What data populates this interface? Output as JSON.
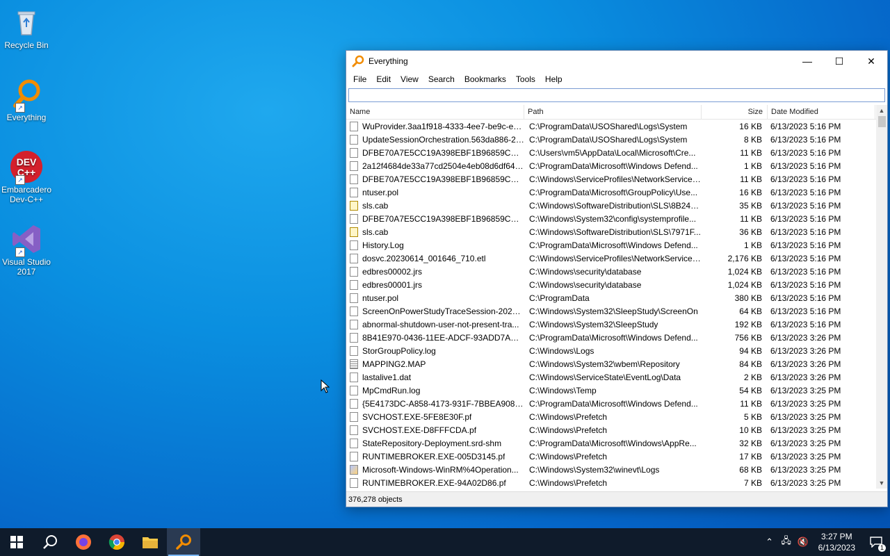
{
  "desktop": {
    "icons": [
      {
        "label": "Recycle Bin"
      },
      {
        "label": "Everything"
      },
      {
        "label": "Embarcadero Dev-C++"
      },
      {
        "label": "Visual Studio 2017"
      }
    ]
  },
  "window": {
    "title": "Everything",
    "controls": {
      "minimize": "—",
      "maximize": "☐",
      "close": "✕"
    },
    "menu": [
      "File",
      "Edit",
      "View",
      "Search",
      "Bookmarks",
      "Tools",
      "Help"
    ],
    "search": {
      "value": "",
      "placeholder": ""
    },
    "columns": {
      "name": "Name",
      "path": "Path",
      "size": "Size",
      "date": "Date Modified"
    },
    "rows": [
      {
        "name": "WuProvider.3aa1f918-4333-4ee7-be9c-e5a...",
        "path": "C:\\ProgramData\\USOShared\\Logs\\System",
        "size": "16 KB",
        "date": "6/13/2023 5:16 PM",
        "icon": "file"
      },
      {
        "name": "UpdateSessionOrchestration.563da886-21...",
        "path": "C:\\ProgramData\\USOShared\\Logs\\System",
        "size": "8 KB",
        "date": "6/13/2023 5:16 PM",
        "icon": "file"
      },
      {
        "name": "DFBE70A7E5CC19A398EBF1B96859CE5D",
        "path": "C:\\Users\\vm5\\AppData\\Local\\Microsoft\\Cre...",
        "size": "11 KB",
        "date": "6/13/2023 5:16 PM",
        "icon": "file"
      },
      {
        "name": "2a12f4684de33a77cd2504e4eb08d6df649b...",
        "path": "C:\\ProgramData\\Microsoft\\Windows Defend...",
        "size": "1 KB",
        "date": "6/13/2023 5:16 PM",
        "icon": "file"
      },
      {
        "name": "DFBE70A7E5CC19A398EBF1B96859CE5D",
        "path": "C:\\Windows\\ServiceProfiles\\NetworkService\\...",
        "size": "11 KB",
        "date": "6/13/2023 5:16 PM",
        "icon": "file"
      },
      {
        "name": "ntuser.pol",
        "path": "C:\\ProgramData\\Microsoft\\GroupPolicy\\Use...",
        "size": "16 KB",
        "date": "6/13/2023 5:16 PM",
        "icon": "file"
      },
      {
        "name": "sls.cab",
        "path": "C:\\Windows\\SoftwareDistribution\\SLS\\8B24B...",
        "size": "35 KB",
        "date": "6/13/2023 5:16 PM",
        "icon": "cab"
      },
      {
        "name": "DFBE70A7E5CC19A398EBF1B96859CE5D",
        "path": "C:\\Windows\\System32\\config\\systemprofile...",
        "size": "11 KB",
        "date": "6/13/2023 5:16 PM",
        "icon": "file"
      },
      {
        "name": "sls.cab",
        "path": "C:\\Windows\\SoftwareDistribution\\SLS\\7971F...",
        "size": "36 KB",
        "date": "6/13/2023 5:16 PM",
        "icon": "cab"
      },
      {
        "name": "History.Log",
        "path": "C:\\ProgramData\\Microsoft\\Windows Defend...",
        "size": "1 KB",
        "date": "6/13/2023 5:16 PM",
        "icon": "file"
      },
      {
        "name": "dosvc.20230614_001646_710.etl",
        "path": "C:\\Windows\\ServiceProfiles\\NetworkService\\...",
        "size": "2,176 KB",
        "date": "6/13/2023 5:16 PM",
        "icon": "file"
      },
      {
        "name": "edbres00002.jrs",
        "path": "C:\\Windows\\security\\database",
        "size": "1,024 KB",
        "date": "6/13/2023 5:16 PM",
        "icon": "file"
      },
      {
        "name": "edbres00001.jrs",
        "path": "C:\\Windows\\security\\database",
        "size": "1,024 KB",
        "date": "6/13/2023 5:16 PM",
        "icon": "file"
      },
      {
        "name": "ntuser.pol",
        "path": "C:\\ProgramData",
        "size": "380 KB",
        "date": "6/13/2023 5:16 PM",
        "icon": "file"
      },
      {
        "name": "ScreenOnPowerStudyTraceSession-2023-0...",
        "path": "C:\\Windows\\System32\\SleepStudy\\ScreenOn",
        "size": "64 KB",
        "date": "6/13/2023 5:16 PM",
        "icon": "file"
      },
      {
        "name": "abnormal-shutdown-user-not-present-tra...",
        "path": "C:\\Windows\\System32\\SleepStudy",
        "size": "192 KB",
        "date": "6/13/2023 5:16 PM",
        "icon": "file"
      },
      {
        "name": "8B41E970-0436-11EE-ADCF-93ADD7AD677...",
        "path": "C:\\ProgramData\\Microsoft\\Windows Defend...",
        "size": "756 KB",
        "date": "6/13/2023 3:26 PM",
        "icon": "file"
      },
      {
        "name": "StorGroupPolicy.log",
        "path": "C:\\Windows\\Logs",
        "size": "94 KB",
        "date": "6/13/2023 3:26 PM",
        "icon": "file"
      },
      {
        "name": "MAPPING2.MAP",
        "path": "C:\\Windows\\System32\\wbem\\Repository",
        "size": "84 KB",
        "date": "6/13/2023 3:26 PM",
        "icon": "map"
      },
      {
        "name": "lastalive1.dat",
        "path": "C:\\Windows\\ServiceState\\EventLog\\Data",
        "size": "2 KB",
        "date": "6/13/2023 3:26 PM",
        "icon": "file"
      },
      {
        "name": "MpCmdRun.log",
        "path": "C:\\Windows\\Temp",
        "size": "54 KB",
        "date": "6/13/2023 3:25 PM",
        "icon": "file"
      },
      {
        "name": "{5E4173DC-A858-4173-931F-7BBEA908BF4...",
        "path": "C:\\ProgramData\\Microsoft\\Windows Defend...",
        "size": "11 KB",
        "date": "6/13/2023 3:25 PM",
        "icon": "file"
      },
      {
        "name": "SVCHOST.EXE-5FE8E30F.pf",
        "path": "C:\\Windows\\Prefetch",
        "size": "5 KB",
        "date": "6/13/2023 3:25 PM",
        "icon": "file"
      },
      {
        "name": "SVCHOST.EXE-D8FFFCDA.pf",
        "path": "C:\\Windows\\Prefetch",
        "size": "10 KB",
        "date": "6/13/2023 3:25 PM",
        "icon": "file"
      },
      {
        "name": "StateRepository-Deployment.srd-shm",
        "path": "C:\\ProgramData\\Microsoft\\Windows\\AppRe...",
        "size": "32 KB",
        "date": "6/13/2023 3:25 PM",
        "icon": "file"
      },
      {
        "name": "RUNTIMEBROKER.EXE-005D3145.pf",
        "path": "C:\\Windows\\Prefetch",
        "size": "17 KB",
        "date": "6/13/2023 3:25 PM",
        "icon": "file"
      },
      {
        "name": "Microsoft-Windows-WinRM%4Operation...",
        "path": "C:\\Windows\\System32\\winevt\\Logs",
        "size": "68 KB",
        "date": "6/13/2023 3:25 PM",
        "icon": "evt"
      },
      {
        "name": "RUNTIMEBROKER.EXE-94A02D86.pf",
        "path": "C:\\Windows\\Prefetch",
        "size": "7 KB",
        "date": "6/13/2023 3:25 PM",
        "icon": "file"
      }
    ],
    "status": "376,278 objects"
  },
  "taskbar": {
    "clock_time": "3:27 PM",
    "clock_date": "6/13/2023",
    "notification_count": "1"
  },
  "colors": {
    "accent": "#0078d7",
    "everything_orange": "#f28c00"
  }
}
